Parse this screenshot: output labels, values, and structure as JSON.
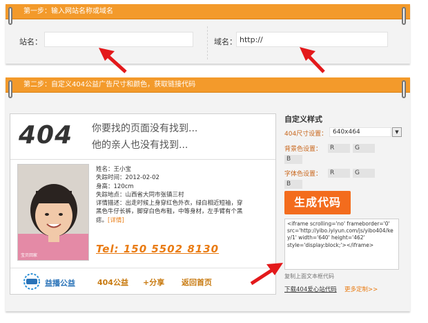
{
  "step1": {
    "title": "第一步：输入网站名称或域名",
    "site_name_label": "站名：",
    "site_name_value": "",
    "domain_label": "域名：",
    "domain_value": "http://"
  },
  "step2": {
    "title": "第二步：自定义404公益广告尺寸和颜色，获取链接代码"
  },
  "preview": {
    "code_404": "404",
    "message_line1": "你要找的页面没有找到...",
    "message_line2": "他的亲人也没有找到...",
    "info_lines": [
      "姓名：王小宝",
      "失踪时间：2012-02-02",
      "身高：120cm",
      "失踪地点：山西省大同市张镇三村",
      "详情描述：出走时候上身穿红色外衣，绿白相近短袖，穿",
      "黑色牛仔长裤，脚穿白色布鞋，中等身材，左手臂有个黑"
    ],
    "info_last": "痣。",
    "detail_link": "[详情]",
    "phone": "Tel: 150 5502 8130",
    "photo_caption": "宝贝回家",
    "footer": {
      "logo_text": "益播公益",
      "link_charity": "404公益",
      "link_share": "+分享",
      "link_home": "返回首页"
    }
  },
  "customize": {
    "title": "自定义样式",
    "size_label": "404尺寸设置：",
    "size_value": "640x464",
    "bg_label": "背景色设置：",
    "font_label": "字体色设置：",
    "color_fields": {
      "r": "R",
      "g": "G",
      "b": "B"
    },
    "generate_button": "生成代码",
    "code_output": "<iframe scrolling='no' frameborder='0' src='http://yibo.iyiyun.com/js/yibo404/key/1' width='640' height='462' style='display:block;'></iframe>",
    "copy_hint": "复制上面文本框代码",
    "download_link": "下载404爱心站代码",
    "more_link": "更多定制>>"
  },
  "colors": {
    "header_bar": "#f39a2b",
    "generate_button": "#f36c1d",
    "link_orange": "#e97b12",
    "arrow_red": "#e3191b"
  }
}
